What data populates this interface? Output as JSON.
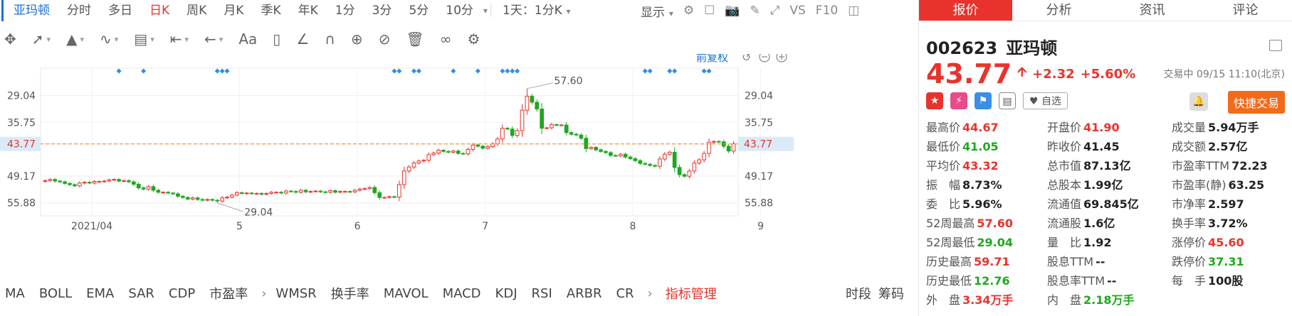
{
  "toolbar": {
    "stock_tab": "亚玛顿",
    "period_tabs": [
      "分时",
      "多日",
      "日K",
      "周K",
      "月K",
      "季K",
      "年K",
      "1分",
      "3分",
      "5分",
      "10分"
    ],
    "active_period": "日K",
    "range_select": "1天：1分K",
    "display_label": "显示",
    "vs_label": "VS",
    "f10_label": "F10"
  },
  "drawing_tools": [
    "move-tool",
    "line-tool",
    "channel-tool",
    "wave-tool",
    "fib-tool",
    "measure-tool",
    "arrow-tool",
    "text-tool",
    "comment-tool",
    "angle-tool",
    "magnet-tool",
    "lock-tool",
    "hide-tool",
    "delete-tool",
    "link-tool",
    "settings-tool"
  ],
  "drawing_text_label": "Aa",
  "chart": {
    "adjust_label": "前复权",
    "price_labels_left": [
      "55.88",
      "49.17",
      "43.77",
      "35.75",
      "29.04"
    ],
    "price_labels_right": [
      "55.88",
      "49.17",
      "43.77",
      "35.75",
      "29.04"
    ],
    "current_price_label": "43.77",
    "high_label": "57.60",
    "low_label": "29.04",
    "x_labels": [
      "2021/04",
      "5",
      "6",
      "7",
      "8",
      "9"
    ]
  },
  "chart_data": {
    "type": "candlestick",
    "y_ticks": [
      29.04,
      35.75,
      43.77,
      49.17,
      55.88
    ],
    "ylim": [
      25.8,
      62.7
    ],
    "current_price": 43.77,
    "period_high": 57.6,
    "period_low": 29.04,
    "x_labels": [
      "2021/04",
      "5",
      "6",
      "7",
      "8",
      "9"
    ],
    "closes": [
      34.6,
      34.9,
      34.5,
      34.3,
      33.9,
      33.6,
      33.3,
      34.0,
      34.2,
      34.0,
      34.4,
      34.4,
      34.5,
      34.8,
      34.9,
      34.5,
      34.6,
      34.3,
      33.7,
      32.8,
      32.5,
      33.1,
      32.2,
      31.7,
      31.7,
      31.5,
      31.3,
      30.7,
      30.4,
      30.0,
      30.3,
      29.9,
      29.7,
      29.9,
      29.7,
      29.5,
      30.3,
      30.5,
      31.0,
      31.6,
      31.4,
      31.5,
      31.4,
      31.4,
      31.2,
      31.4,
      31.7,
      31.7,
      31.5,
      32.0,
      31.9,
      31.7,
      32.2,
      31.8,
      31.9,
      32.0,
      31.8,
      31.7,
      32.1,
      31.7,
      31.9,
      31.9,
      31.8,
      32.2,
      32.5,
      32.6,
      32.9,
      31.6,
      30.4,
      30.4,
      30.6,
      30.5,
      33.6,
      37.0,
      38.0,
      39.0,
      39.5,
      39.7,
      41.1,
      41.5,
      42.2,
      41.9,
      41.7,
      42.0,
      41.4,
      41.3,
      42.4,
      43.5,
      43.2,
      42.7,
      43.1,
      43.8,
      45.0,
      47.7,
      47.5,
      45.9,
      47.1,
      52.2,
      55.7,
      54.2,
      52.5,
      47.7,
      47.8,
      48.6,
      48.5,
      48.5,
      46.6,
      46.2,
      46.0,
      45.2,
      42.6,
      42.9,
      42.3,
      41.9,
      41.6,
      40.9,
      40.8,
      41.2,
      40.5,
      40.1,
      39.6,
      38.9,
      38.7,
      38.4,
      38.2,
      40.0,
      41.2,
      41.7,
      37.9,
      36.1,
      35.7,
      37.0,
      39.0,
      39.8,
      41.4,
      44.2,
      44.4,
      44.3,
      43.2,
      42.0,
      43.8
    ]
  },
  "indicators": [
    "MA",
    "BOLL",
    "EMA",
    "SAR",
    "CDP",
    "市盈率",
    "WMSR",
    "换手率",
    "MAVOL",
    "MACD",
    "KDJ",
    "RSI",
    "ARBR",
    "CR"
  ],
  "indicator_manage": "指标管理",
  "bottom_right_links": [
    "时段",
    "筹码"
  ],
  "right_panel": {
    "tabs": [
      "报价",
      "分析",
      "资讯",
      "评论"
    ],
    "active_tab": "报价",
    "code": "002623",
    "name": "亚玛顿",
    "price": "43.77",
    "change": "+2.32",
    "change_pct": "+5.60%",
    "status": "交易中 09/15 11:10(北京)",
    "watch_label": "自选",
    "trade_label": "快捷交易",
    "stats": [
      {
        "label": "最高价",
        "value": "44.67",
        "color": "red"
      },
      {
        "label": "开盘价",
        "value": "41.90",
        "color": "red"
      },
      {
        "label": "成交量",
        "value": "5.94万手",
        "color": "dark"
      },
      {
        "label": "最低价",
        "value": "41.05",
        "color": "green"
      },
      {
        "label": "昨收价",
        "value": "41.45",
        "color": "dark"
      },
      {
        "label": "成交额",
        "value": "2.57亿",
        "color": "dark"
      },
      {
        "label": "平均价",
        "value": "43.32",
        "color": "red"
      },
      {
        "label": "总市值",
        "value": "87.13亿",
        "color": "dark"
      },
      {
        "label": "市盈率TTM",
        "value": "72.23",
        "color": "dark"
      },
      {
        "label": "振　幅",
        "value": "8.73%",
        "color": "dark"
      },
      {
        "label": "总股本",
        "value": "1.99亿",
        "color": "dark"
      },
      {
        "label": "市盈率(静)",
        "value": "63.25",
        "color": "dark"
      },
      {
        "label": "委　比",
        "value": "5.96%",
        "color": "dark"
      },
      {
        "label": "流通值",
        "value": "69.845亿",
        "color": "dark"
      },
      {
        "label": "市净率",
        "value": "2.597",
        "color": "dark"
      },
      {
        "label": "52周最高",
        "value": "57.60",
        "color": "red"
      },
      {
        "label": "流通股",
        "value": "1.6亿",
        "color": "dark"
      },
      {
        "label": "换手率",
        "value": "3.72%",
        "color": "dark"
      },
      {
        "label": "52周最低",
        "value": "29.04",
        "color": "green"
      },
      {
        "label": "量　比",
        "value": "1.92",
        "color": "dark"
      },
      {
        "label": "涨停价",
        "value": "45.60",
        "color": "red"
      },
      {
        "label": "历史最高",
        "value": "59.71",
        "color": "red"
      },
      {
        "label": "股息TTM",
        "value": "--",
        "color": "dark"
      },
      {
        "label": "跌停价",
        "value": "37.31",
        "color": "green"
      },
      {
        "label": "历史最低",
        "value": "12.76",
        "color": "green"
      },
      {
        "label": "股息率TTM",
        "value": "--",
        "color": "dark"
      },
      {
        "label": "每　手",
        "value": "100股",
        "color": "dark"
      },
      {
        "label": "外　盘",
        "value": "3.34万手",
        "color": "red"
      },
      {
        "label": "内　盘",
        "value": "2.18万手",
        "color": "green"
      },
      {
        "label": "",
        "value": "",
        "color": "dark"
      }
    ]
  },
  "colors": {
    "up": "#e8332d",
    "down": "#1ea81e",
    "accent": "#1a6fd8",
    "trade_button": "#f26a1b",
    "price_line": "#f0883c"
  }
}
